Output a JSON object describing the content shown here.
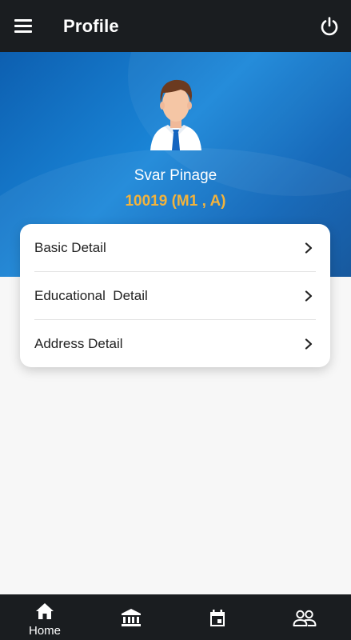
{
  "app_bar": {
    "title": "Profile",
    "menu_icon": "hamburger-menu-icon",
    "power_icon": "power-icon"
  },
  "profile": {
    "name": "Svar Pinage",
    "code": "10019 (M1 , A)",
    "avatar": "male-avatar"
  },
  "details": [
    {
      "label": "Basic Detail"
    },
    {
      "label": "Educational  Detail"
    },
    {
      "label": "Address Detail"
    }
  ],
  "bottom_nav": [
    {
      "label": "Home",
      "icon": "home-icon"
    },
    {
      "label": "",
      "icon": "bank-icon"
    },
    {
      "label": "",
      "icon": "calendar-icon"
    },
    {
      "label": "",
      "icon": "people-icon"
    }
  ],
  "colors": {
    "app_bar": "#1a1d20",
    "hero_blue": "#1a86d8",
    "code_accent": "#f2b33d"
  }
}
